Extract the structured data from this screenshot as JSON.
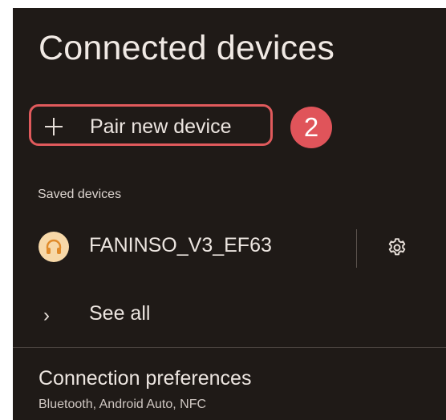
{
  "page": {
    "title": "Connected devices"
  },
  "pair": {
    "label": "Pair new device",
    "icon": "plus-icon"
  },
  "annotation": {
    "step": "2",
    "highlight_color": "#e05a5c"
  },
  "saved_devices": {
    "section_label": "Saved devices",
    "items": [
      {
        "name": "FANINSO_V3_EF63",
        "icon": "headphones-icon",
        "settings_icon": "gear-icon"
      }
    ]
  },
  "see_all": {
    "label": "See all",
    "icon": "chevron-right-icon"
  },
  "preferences": {
    "title": "Connection preferences",
    "subtitle": "Bluetooth, Android Auto, NFC"
  },
  "colors": {
    "background": "#1f1a17",
    "text": "#ece5e0",
    "avatar": "#f7d8a8",
    "accent": "#e0545a"
  }
}
